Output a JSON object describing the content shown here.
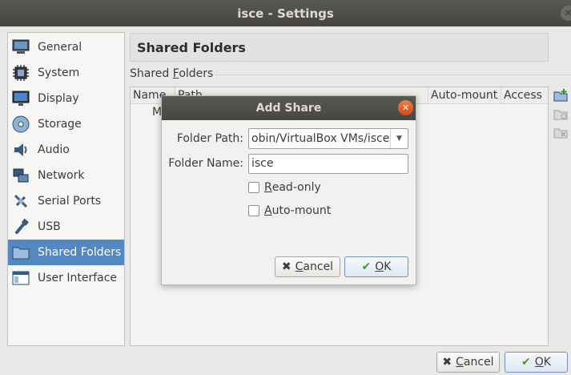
{
  "window": {
    "title": "isce - Settings",
    "close_glyph": "✕"
  },
  "sidebar": {
    "items": [
      {
        "label": "General",
        "icon": "general-icon"
      },
      {
        "label": "System",
        "icon": "system-icon"
      },
      {
        "label": "Display",
        "icon": "display-icon"
      },
      {
        "label": "Storage",
        "icon": "storage-icon"
      },
      {
        "label": "Audio",
        "icon": "audio-icon"
      },
      {
        "label": "Network",
        "icon": "network-icon"
      },
      {
        "label": "Serial Ports",
        "icon": "serial-ports-icon"
      },
      {
        "label": "USB",
        "icon": "usb-icon"
      },
      {
        "label": "Shared Folders",
        "icon": "shared-folders-icon",
        "active": true
      },
      {
        "label": "User Interface",
        "icon": "user-interface-icon"
      }
    ]
  },
  "main": {
    "header": "Shared Folders",
    "group_label_pre": "Shared ",
    "group_label_mnemonic": "F",
    "group_label_post": "olders",
    "columns": [
      "Name",
      "Path",
      "Auto-mount",
      "Access"
    ],
    "row_name_fragment": "M"
  },
  "buttons": {
    "cancel_mnemonic": "C",
    "cancel_rest": "ancel",
    "ok_mnemonic": "O",
    "ok_rest": "K"
  },
  "dialog": {
    "title": "Add Share",
    "close_glyph": "✕",
    "folder_path_label": "Folder Path:",
    "folder_path_value": "obin/VirtualBox VMs/isce",
    "folder_name_label": "Folder Name:",
    "folder_name_value": "isce",
    "readonly_mnemonic": "R",
    "readonly_rest": "ead-only",
    "automount_mnemonic": "A",
    "automount_rest": "uto-mount",
    "cancel_mnemonic": "C",
    "cancel_rest": "ancel",
    "ok_mnemonic": "O",
    "ok_rest": "K"
  },
  "colors": {
    "accent": "#5388c2",
    "titlebar": "#45443f",
    "dialog_close": "#dd4814"
  }
}
